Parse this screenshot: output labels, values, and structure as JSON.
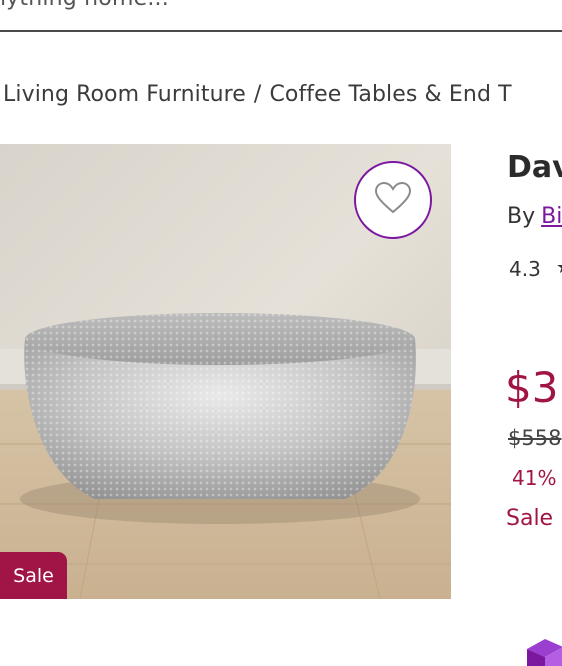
{
  "search": {
    "placeholder": "nything home..."
  },
  "breadcrumb": {
    "items": [
      "Living Room Furniture",
      "Coffee Tables & End T"
    ],
    "separator": "/"
  },
  "product": {
    "title": "Dav",
    "by_prefix": "By",
    "brand": "Bi",
    "rating": "4.3",
    "sale_price": "$3",
    "original_price": "$558",
    "discount": "41%",
    "sale_label": "Sale",
    "image_badge": "Sale"
  },
  "colors": {
    "accent_purple": "#7b189f",
    "sale_red": "#a01545"
  },
  "icons": {
    "favorite": "heart-outline-icon",
    "rating": "star-icon"
  }
}
